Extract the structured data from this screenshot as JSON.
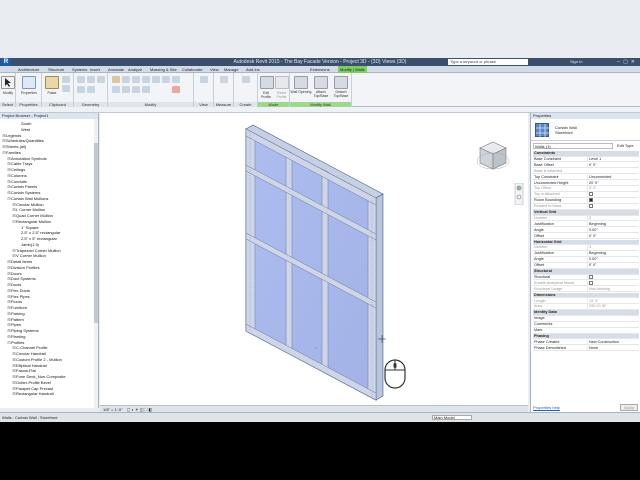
{
  "window": {
    "title": "Autodesk Revit 2015 - The Bay Facade Version - Project 3D - {3D} Views (3D)",
    "search_placeholder": "Type a keyword or phrase",
    "user_label": "Sign In",
    "logo": "R"
  },
  "ribbon": {
    "tabs": [
      "Architecture",
      "Structure",
      "Systems",
      "Insert",
      "Annotate",
      "Analyze",
      "Massing & Site",
      "Collaborate",
      "View",
      "Manage",
      "Add-Ins",
      "Extensions",
      "Modify | Walls"
    ],
    "active_tab": "Modify | Walls",
    "groups": [
      "Select",
      "Properties",
      "Clipboard",
      "Geometry",
      "Modify",
      "View",
      "Measure",
      "Create",
      "Mode",
      "Modify Wall"
    ],
    "buttons": {
      "modify": "Modify",
      "properties": "Properties",
      "paste": "Paste",
      "cut": "Cut",
      "join": "Join",
      "edit_profile": "Edit Profile",
      "reset_profile": "Reset Profile",
      "wall_opening": "Wall Opening",
      "attach_top_base": "Attach Top/Base",
      "detach_top_base": "Detach Top/Base"
    }
  },
  "project_browser": {
    "title": "Project Browser - Project1",
    "items": [
      {
        "level": 3,
        "exp": "",
        "label": "South"
      },
      {
        "level": 3,
        "exp": "",
        "label": "West"
      },
      {
        "level": 0,
        "exp": "⊞",
        "label": "Legends"
      },
      {
        "level": 0,
        "exp": "⊞",
        "label": "Schedules/Quantities"
      },
      {
        "level": 0,
        "exp": "⊞",
        "label": "Sheets (all)"
      },
      {
        "level": 0,
        "exp": "⊟",
        "label": "Families"
      },
      {
        "level": 1,
        "exp": "⊞",
        "label": "Annotation Symbols"
      },
      {
        "level": 1,
        "exp": "⊞",
        "label": "Cable Trays"
      },
      {
        "level": 1,
        "exp": "⊞",
        "label": "Ceilings"
      },
      {
        "level": 1,
        "exp": "⊞",
        "label": "Columns"
      },
      {
        "level": 1,
        "exp": "⊞",
        "label": "Conduits"
      },
      {
        "level": 1,
        "exp": "⊞",
        "label": "Curtain Panels"
      },
      {
        "level": 1,
        "exp": "⊞",
        "label": "Curtain Systems"
      },
      {
        "level": 1,
        "exp": "⊟",
        "label": "Curtain Wall Mullions"
      },
      {
        "level": 2,
        "exp": "⊞",
        "label": "Circular Mullion"
      },
      {
        "level": 2,
        "exp": "⊞",
        "label": "L Corner Mullion"
      },
      {
        "level": 2,
        "exp": "⊞",
        "label": "Quad Corner Mullion"
      },
      {
        "level": 2,
        "exp": "⊟",
        "label": "Rectangular Mullion"
      },
      {
        "level": 3,
        "exp": "",
        "label": "1\" Square"
      },
      {
        "level": 3,
        "exp": "",
        "label": "2.5\" x 2.5\" rectangular"
      },
      {
        "level": 3,
        "exp": "",
        "label": "2.5\" x 5\" rectangular"
      },
      {
        "level": 3,
        "exp": "",
        "label": "Jamb(1.5)"
      },
      {
        "level": 2,
        "exp": "⊞",
        "label": "Trapezoid Corner Mullion"
      },
      {
        "level": 2,
        "exp": "⊞",
        "label": "V Corner Mullion"
      },
      {
        "level": 1,
        "exp": "⊞",
        "label": "Detail Items"
      },
      {
        "level": 1,
        "exp": "⊞",
        "label": "Division Profiles"
      },
      {
        "level": 1,
        "exp": "⊞",
        "label": "Doors"
      },
      {
        "level": 1,
        "exp": "⊞",
        "label": "Duct Systems"
      },
      {
        "level": 1,
        "exp": "⊞",
        "label": "Ducts"
      },
      {
        "level": 1,
        "exp": "⊞",
        "label": "Flex Ducts"
      },
      {
        "level": 1,
        "exp": "⊞",
        "label": "Flex Pipes"
      },
      {
        "level": 1,
        "exp": "⊞",
        "label": "Floors"
      },
      {
        "level": 1,
        "exp": "⊞",
        "label": "Furniture"
      },
      {
        "level": 1,
        "exp": "⊞",
        "label": "Parking"
      },
      {
        "level": 1,
        "exp": "⊞",
        "label": "Pattern"
      },
      {
        "level": 1,
        "exp": "⊞",
        "label": "Pipes"
      },
      {
        "level": 1,
        "exp": "⊞",
        "label": "Piping Systems"
      },
      {
        "level": 1,
        "exp": "⊞",
        "label": "Planting"
      },
      {
        "level": 1,
        "exp": "⊟",
        "label": "Profiles"
      },
      {
        "level": 2,
        "exp": "⊞",
        "label": "C-Channel Profile"
      },
      {
        "level": 2,
        "exp": "⊞",
        "label": "Circular Handrail"
      },
      {
        "level": 2,
        "exp": "⊞",
        "label": "Custom Profile 2 - Mullion"
      },
      {
        "level": 2,
        "exp": "⊞",
        "label": "Elliptical Handrail"
      },
      {
        "level": 2,
        "exp": "⊞",
        "label": "Fascia-Flat"
      },
      {
        "level": 2,
        "exp": "⊞",
        "label": "Form Deck_Non-Composite"
      },
      {
        "level": 2,
        "exp": "⊞",
        "label": "Gutter-Profile Bevel"
      },
      {
        "level": 2,
        "exp": "⊞",
        "label": "Parapet Cap Precast"
      },
      {
        "level": 2,
        "exp": "⊞",
        "label": "Rectangular Handrail"
      }
    ]
  },
  "properties": {
    "title": "Properties",
    "family": "Curtain Wall",
    "type": "Storefront",
    "filter": "Walls (1)",
    "edit_type": "Edit Type",
    "rows": [
      {
        "sec": true,
        "n": "Constraints",
        "v": ""
      },
      {
        "n": "Base Constraint",
        "v": "Level 1"
      },
      {
        "n": "Base Offset",
        "v": "0' 0\""
      },
      {
        "n": "Base is Attached",
        "v": "",
        "grey": true
      },
      {
        "n": "Top Constraint",
        "v": "Unconnected"
      },
      {
        "n": "Unconnected Height",
        "v": "20' 0\""
      },
      {
        "n": "Top Offset",
        "v": "0' 0\"",
        "grey": true
      },
      {
        "n": "Top is Attached",
        "v": "",
        "grey": true,
        "cb": false
      },
      {
        "n": "Room Bounding",
        "v": "",
        "cb": true
      },
      {
        "n": "Related to Mass",
        "v": "",
        "grey": true,
        "cb": false
      },
      {
        "sec": true,
        "n": "Vertical Grid",
        "v": ""
      },
      {
        "n": "Number",
        "v": "3",
        "grey": true
      },
      {
        "n": "Justification",
        "v": "Beginning"
      },
      {
        "n": "Angle",
        "v": "0.00°"
      },
      {
        "n": "Offset",
        "v": "0' 0\""
      },
      {
        "sec": true,
        "n": "Horizontal Grid",
        "v": ""
      },
      {
        "n": "Number",
        "v": "3",
        "grey": true
      },
      {
        "n": "Justification",
        "v": "Beginning"
      },
      {
        "n": "Angle",
        "v": "0.00°"
      },
      {
        "n": "Offset",
        "v": "0' 0\""
      },
      {
        "sec": true,
        "n": "Structural",
        "v": ""
      },
      {
        "n": "Structural",
        "v": "",
        "cb": false
      },
      {
        "n": "Enable Analytical Model",
        "v": "",
        "grey": true,
        "cb": false
      },
      {
        "n": "Structural Usage",
        "v": "Non-bearing",
        "grey": true
      },
      {
        "sec": true,
        "n": "Dimensions",
        "v": ""
      },
      {
        "n": "Length",
        "v": "15' 0\"",
        "grey": true
      },
      {
        "n": "Area",
        "v": "290.00 SF",
        "grey": true
      },
      {
        "sec": true,
        "n": "Identity Data",
        "v": ""
      },
      {
        "n": "Image",
        "v": ""
      },
      {
        "n": "Comments",
        "v": ""
      },
      {
        "n": "Mark",
        "v": ""
      },
      {
        "sec": true,
        "n": "Phasing",
        "v": ""
      },
      {
        "n": "Phase Created",
        "v": "New Construction"
      },
      {
        "n": "Phase Demolished",
        "v": "None"
      }
    ],
    "help_link": "Properties help",
    "apply": "Apply"
  },
  "viewbar": {
    "scale": "1/8\" = 1'-0\""
  },
  "status": {
    "text": "Walls : Curtain Wall : Storefront",
    "model": "Main Model"
  },
  "colors": {
    "glass": "#a9b9ea",
    "mullion": "#c4cde0",
    "active_tab": "#7fcf5f"
  }
}
